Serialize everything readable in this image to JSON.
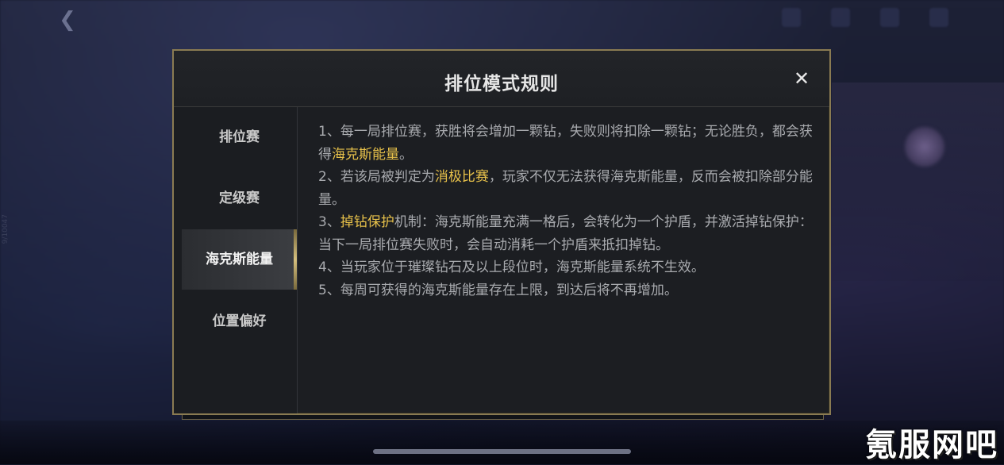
{
  "background": {
    "side_text": "9/10047",
    "watermark": "氪服网吧"
  },
  "modal": {
    "title": "排位模式规则",
    "close_label": "✕",
    "tabs": [
      {
        "label": "排位赛",
        "active": false
      },
      {
        "label": "定级赛",
        "active": false
      },
      {
        "label": "海克斯能量",
        "active": true
      },
      {
        "label": "位置偏好",
        "active": false
      }
    ],
    "rules": [
      {
        "pre": "1、每一局排位赛，获胜将会增加一颗钻，失败则将扣除一颗钻；无论胜负，都会获得",
        "hl": "海克斯能量",
        "post": "。"
      },
      {
        "pre": "2、若该局被判定为",
        "hl": "消极比赛",
        "post": "，玩家不仅无法获得海克斯能量，反而会被扣除部分能量。"
      },
      {
        "pre": "3、",
        "hl": "掉钻保护",
        "post": "机制：海克斯能量充满一格后，会转化为一个护盾，并激活掉钻保护：当下一局排位赛失败时，会自动消耗一个护盾来抵扣掉钻。"
      },
      {
        "pre": "4、当玩家位于璀璨钻石及以上段位时，海克斯能量系统不生效。",
        "hl": "",
        "post": ""
      },
      {
        "pre": "5、每周可获得的海克斯能量存在上限，到达后将不再增加。",
        "hl": "",
        "post": ""
      }
    ]
  },
  "colors": {
    "highlight": "#e7c14a",
    "border_gold": "#8a7b52",
    "modal_bg": "#1c1e22",
    "text": "#a9abaf"
  }
}
